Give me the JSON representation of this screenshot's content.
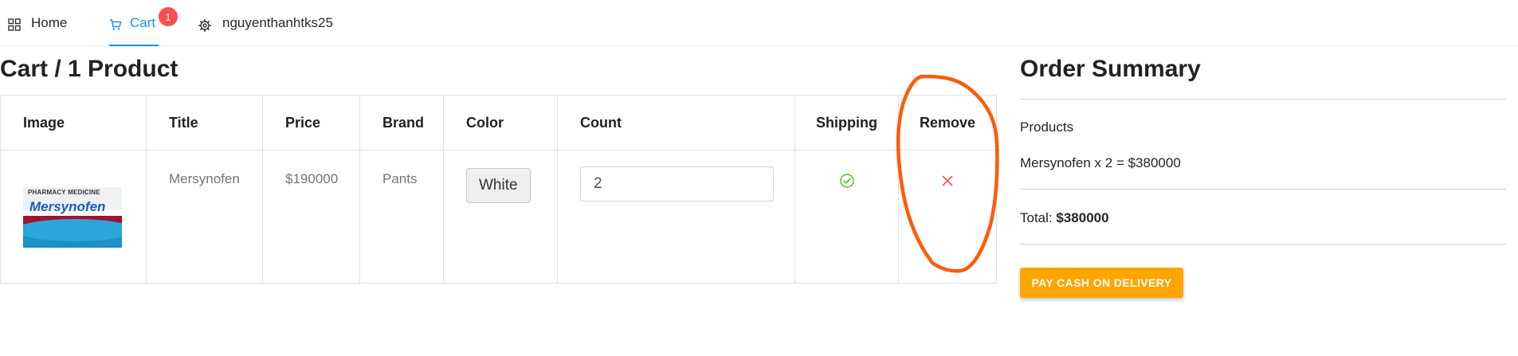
{
  "nav": {
    "home_label": "Home",
    "cart_label": "Cart",
    "cart_badge": "1",
    "user_label": "nguyenthanhtks25"
  },
  "cart": {
    "heading": "Cart / 1 Product",
    "columns": [
      "Image",
      "Title",
      "Price",
      "Brand",
      "Color",
      "Count",
      "Shipping",
      "Remove"
    ],
    "rows": [
      {
        "image": {
          "header_text": "PHARMACY MEDICINE",
          "brand_text": "Mersynofen"
        },
        "title": "Mersynofen",
        "price": "$190000",
        "brand": "Pants",
        "color": "White",
        "count": "2",
        "shipping_icon": "check-circle-icon",
        "remove_icon": "close-icon"
      }
    ]
  },
  "summary": {
    "title": "Order Summary",
    "products_label": "Products",
    "line_item": "Mersynofen x 2 = $380000",
    "total_label": "Total:",
    "total_value": "$380000",
    "pay_button": "PAY CASH ON DELIVERY"
  },
  "colors": {
    "accent": "#1890ff",
    "badge": "#ff4d4f",
    "pay_button": "#ffa500",
    "success": "#52c41a",
    "remove": "#ff4d4f",
    "annotation": "#ff5a0a"
  }
}
